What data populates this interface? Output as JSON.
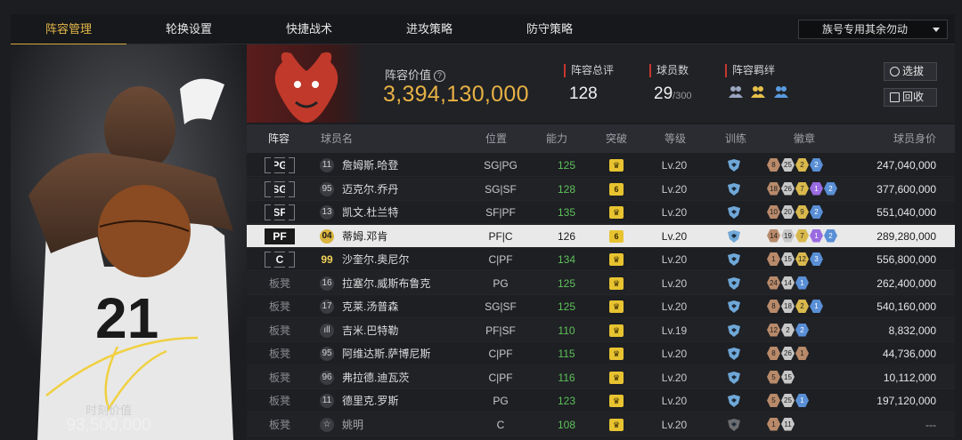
{
  "tabs": [
    "阵容管理",
    "轮换设置",
    "快捷战术",
    "进攻策略",
    "防守策略"
  ],
  "dropdown": {
    "label": "族号专用其余勿动"
  },
  "card": {
    "number": "21",
    "value_label": "时刻价值",
    "value": "93,500,000"
  },
  "info": {
    "team_logo_text": "CHICAGO BULLS",
    "value_label": "阵容价值",
    "value": "3,394,130,000",
    "rating_label": "阵容总评",
    "rating": "128",
    "players_label": "球员数",
    "players": "29",
    "players_max": "/300",
    "chem_label": "阵容羁绊",
    "chem_icons": [
      "team-chem-icon",
      "team-chem-icon",
      "team-chem-icon"
    ],
    "btn_scout": "选拔",
    "btn_recycle": "回收"
  },
  "table": {
    "headers": [
      "阵容",
      "球员名",
      "位置",
      "能力",
      "突破",
      "等级",
      "训练",
      "徽章",
      "球员身价"
    ],
    "rows": [
      {
        "slot": "PG",
        "num": "11",
        "name": "詹姆斯.哈登",
        "pos": "SG|PG",
        "rating": "125",
        "break": "♛",
        "level": "Lv.20",
        "badges": [
          [
            "bronze",
            "8"
          ],
          [
            "silver",
            "25"
          ],
          [
            "gold",
            "2"
          ],
          [
            "blue",
            "2"
          ]
        ],
        "value": "247,040,000"
      },
      {
        "slot": "SG",
        "num": "95",
        "name": "迈克尔.乔丹",
        "pos": "SG|SF",
        "rating": "128",
        "break": "6",
        "level": "Lv.20",
        "badges": [
          [
            "bronze",
            "18"
          ],
          [
            "silver",
            "26"
          ],
          [
            "gold",
            "7"
          ],
          [
            "purple",
            "1"
          ],
          [
            "blue",
            "2"
          ]
        ],
        "value": "377,600,000"
      },
      {
        "slot": "SF",
        "num": "13",
        "name": "凯文.杜兰特",
        "pos": "SF|PF",
        "rating": "135",
        "break": "♛",
        "level": "Lv.20",
        "badges": [
          [
            "bronze",
            "10"
          ],
          [
            "silver",
            "20"
          ],
          [
            "gold",
            "9"
          ],
          [
            "blue",
            "2"
          ]
        ],
        "value": "551,040,000"
      },
      {
        "slot": "PF",
        "num": "04",
        "name": "蒂姆.邓肯",
        "pos": "PF|C",
        "rating": "126",
        "break": "6",
        "level": "Lv.20",
        "badges": [
          [
            "bronze",
            "14"
          ],
          [
            "silver",
            "19"
          ],
          [
            "gold",
            "7"
          ],
          [
            "purple",
            "1"
          ],
          [
            "blue",
            "2"
          ]
        ],
        "value": "289,280,000"
      },
      {
        "slot": "C",
        "num": "99",
        "name": "沙奎尔.奥尼尔",
        "pos": "C|PF",
        "rating": "134",
        "break": "♛",
        "level": "Lv.20",
        "badges": [
          [
            "bronze",
            "1"
          ],
          [
            "silver",
            "15"
          ],
          [
            "gold",
            "12"
          ],
          [
            "blue",
            "3"
          ]
        ],
        "value": "556,800,000"
      },
      {
        "slot": "板凳",
        "num": "16",
        "name": "拉塞尔.威斯布鲁克",
        "pos": "PG",
        "rating": "125",
        "break": "♛",
        "level": "Lv.20",
        "badges": [
          [
            "bronze",
            "24"
          ],
          [
            "silver",
            "14"
          ],
          [
            "blue",
            "1"
          ]
        ],
        "value": "262,400,000"
      },
      {
        "slot": "板凳",
        "num": "17",
        "name": "克莱.汤普森",
        "pos": "SG|SF",
        "rating": "125",
        "break": "♛",
        "level": "Lv.20",
        "badges": [
          [
            "bronze",
            "8"
          ],
          [
            "silver",
            "18"
          ],
          [
            "gold",
            "2"
          ],
          [
            "blue",
            "1"
          ]
        ],
        "value": "540,160,000"
      },
      {
        "slot": "板凳",
        "num": "ıll",
        "name": "吉米.巴特勒",
        "pos": "PF|SF",
        "rating": "110",
        "break": "♛",
        "level": "Lv.19",
        "badges": [
          [
            "bronze",
            "12"
          ],
          [
            "silver",
            "2"
          ],
          [
            "blue",
            "2"
          ]
        ],
        "value": "8,832,000"
      },
      {
        "slot": "板凳",
        "num": "95",
        "name": "阿维达斯.萨博尼斯",
        "pos": "C|PF",
        "rating": "115",
        "break": "♛",
        "level": "Lv.20",
        "badges": [
          [
            "bronze",
            "8"
          ],
          [
            "silver",
            "26"
          ],
          [
            "bronze",
            "1"
          ]
        ],
        "value": "44,736,000"
      },
      {
        "slot": "板凳",
        "num": "96",
        "name": "弗拉德.迪瓦茨",
        "pos": "C|PF",
        "rating": "116",
        "break": "♛",
        "level": "Lv.20",
        "badges": [
          [
            "bronze",
            "5"
          ],
          [
            "silver",
            "15"
          ]
        ],
        "value": "10,112,000"
      },
      {
        "slot": "板凳",
        "num": "11",
        "name": "德里克.罗斯",
        "pos": "PG",
        "rating": "123",
        "break": "♛",
        "level": "Lv.20",
        "badges": [
          [
            "bronze",
            "5"
          ],
          [
            "silver",
            "25"
          ],
          [
            "blue",
            "1"
          ]
        ],
        "value": "197,120,000"
      },
      {
        "slot": "板凳",
        "num": "☆",
        "name": "姚明",
        "pos": "C",
        "rating": "108",
        "break": "♛",
        "level": "Lv.20",
        "badges": [
          [
            "bronze",
            "1"
          ],
          [
            "silver",
            "11"
          ]
        ],
        "value": "---"
      }
    ]
  }
}
